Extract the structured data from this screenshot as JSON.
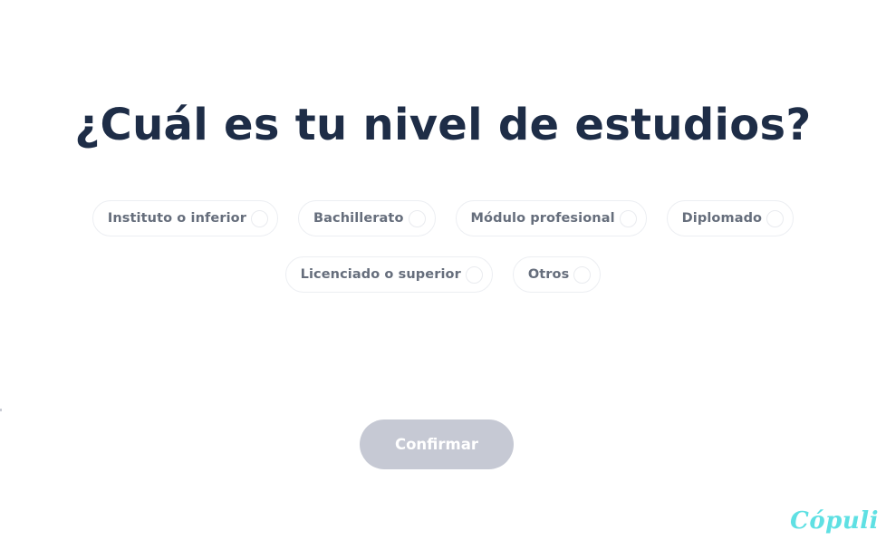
{
  "question": {
    "title": "¿Cuál es tu nivel de estudios?"
  },
  "options": [
    {
      "label": "Instituto o inferior",
      "selected": false
    },
    {
      "label": "Bachillerato",
      "selected": false
    },
    {
      "label": "Módulo profesional",
      "selected": false
    },
    {
      "label": "Diplomado",
      "selected": false
    },
    {
      "label": "Licenciado o superior",
      "selected": false
    },
    {
      "label": "Otros",
      "selected": false
    }
  ],
  "confirm_button": {
    "label": "Confirmar",
    "enabled": false
  },
  "brand": {
    "logo_text": "Cópuli"
  },
  "colors": {
    "title": "#1e2d47",
    "option_text": "#666e7c",
    "option_border": "#eceef2",
    "button_disabled": "#c6c9d4",
    "brand": "#5fe0e3"
  }
}
